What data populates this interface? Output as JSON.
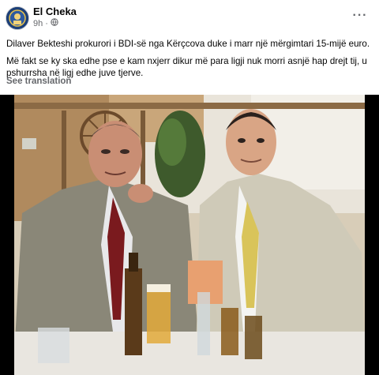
{
  "post": {
    "author": "El Cheka",
    "time": "9h",
    "privacy_icon": "globe-icon",
    "more_icon": "more-options-icon",
    "paragraph_1": "Dilaver Bekteshi prokurori i BDI-së nga Kërçcova duke i marr një mërgimtari 15-mijë euro.",
    "paragraph_2": "Më fakt se ky ska edhe pse e kam nxjerr dikur më para ligji nuk morri asnjë hap drejt tij, u pshurrsha në ligj edhe juve tjerve.",
    "see_translation": "See translation"
  },
  "colors": {
    "author": "#050505",
    "meta": "#65676b",
    "photo_frame": "#000000"
  }
}
